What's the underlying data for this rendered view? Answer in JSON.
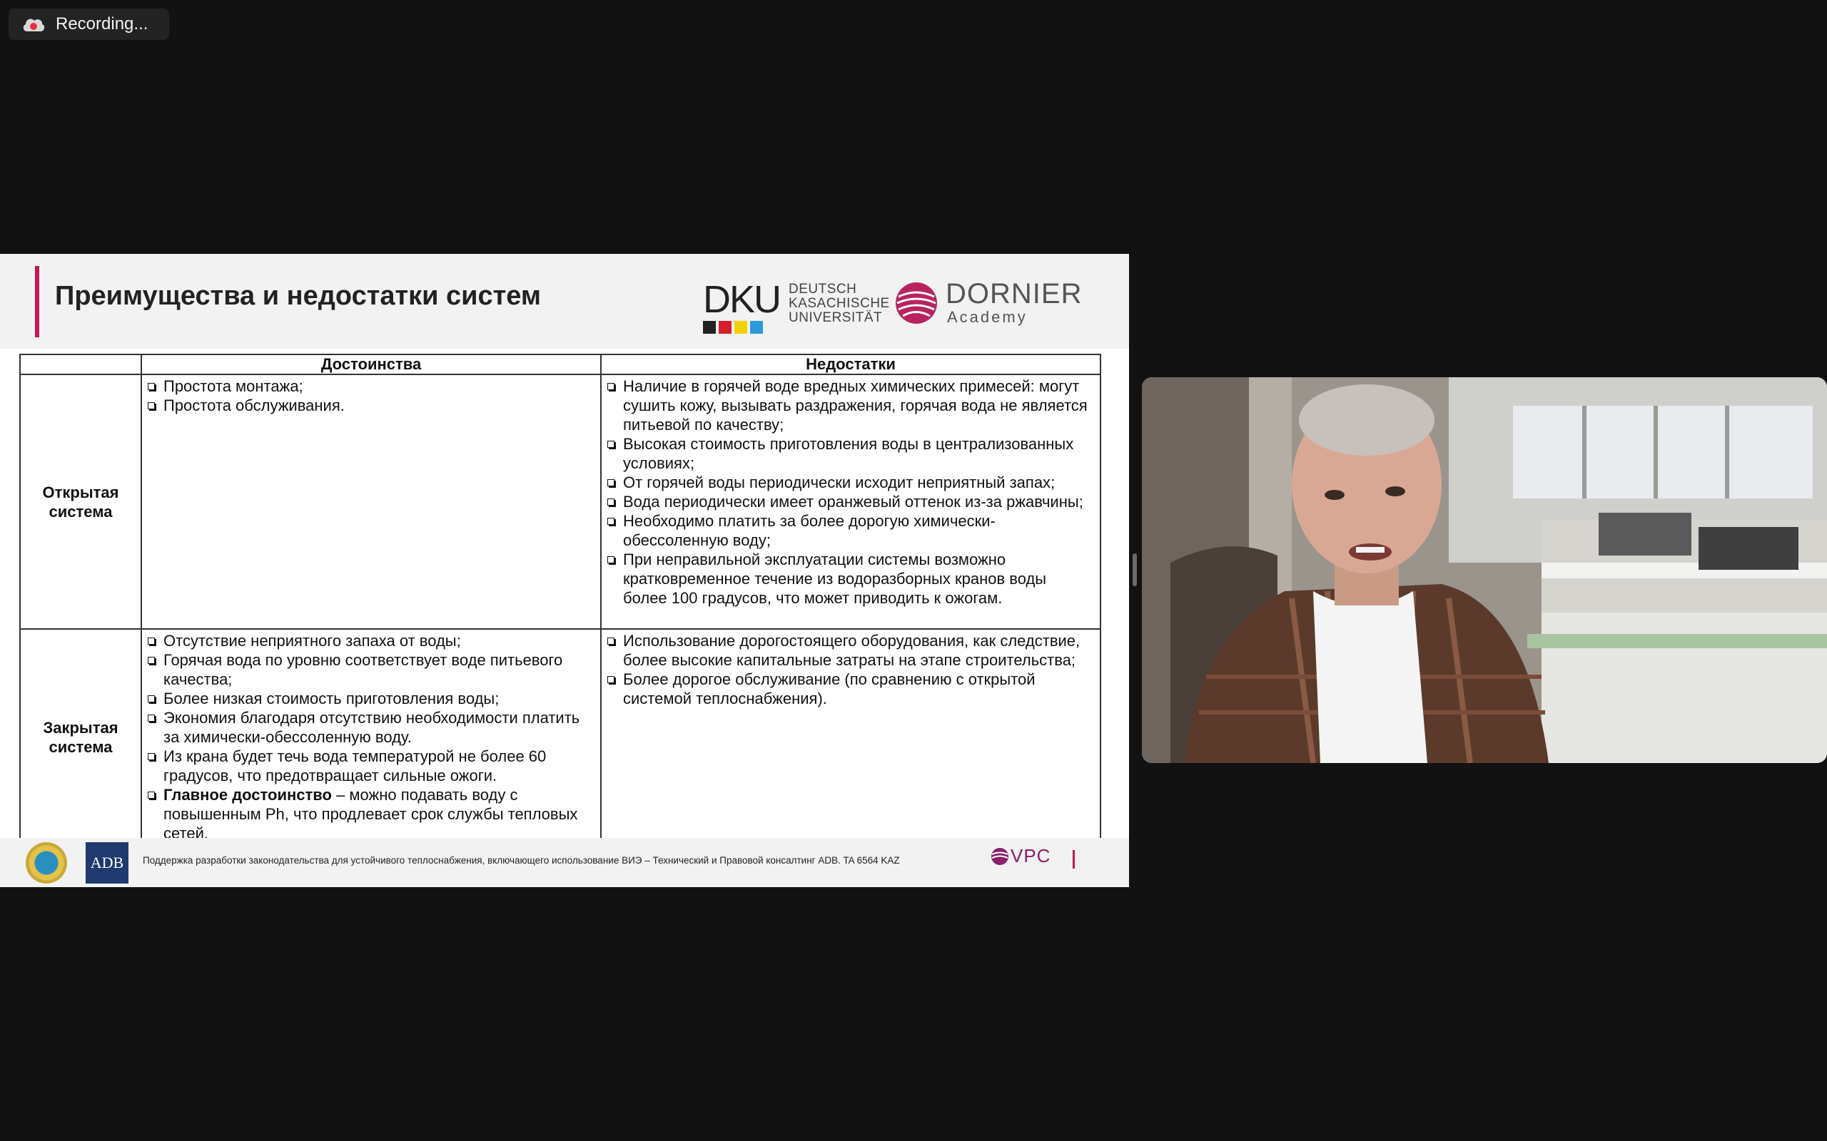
{
  "recording": {
    "label": "Recording..."
  },
  "slide": {
    "title": "Преимущества и недостатки систем",
    "logos": {
      "dku_letters": "DKU",
      "dku_text": [
        "DEUTSCH",
        "KASACHISCHE",
        "UNIVERSITÄT"
      ],
      "dornier_name": "DORNIER",
      "dornier_sub": "Academy",
      "adb": "ADB",
      "vpc": "VPC"
    },
    "table": {
      "headers": [
        "Достоинства",
        "Недостатки"
      ],
      "rows": [
        {
          "label": "Открытая система",
          "advantages": [
            "Простота монтажа;",
            "Простота обслуживания."
          ],
          "disadvantages": [
            "Наличие в горячей воде вредных химических примесей: могут сушить кожу, вызывать раздражения, горячая вода не является питьевой по качеству;",
            "Высокая стоимость приготовления воды в централизованных условиях;",
            "От горячей воды периодически исходит неприятный запах;",
            "Вода периодически имеет оранжевый оттенок из-за ржавчины;",
            "Необходимо платить за более дорогую химически-обессоленную воду;",
            "При неправильной эксплуатации системы возможно кратковременное течение из водоразборных кранов воды более 100 градусов, что может приводить к ожогам."
          ]
        },
        {
          "label": "Закрытая система",
          "advantages": [
            "Отсутствие неприятного запаха от воды;",
            "Горячая вода по уровню соответствует воде питьевого качества;",
            "Более низкая стоимость приготовления воды;",
            "Экономия благодаря отсутствию необходимости платить за химически-обессоленную воду.",
            "Из крана будет течь вода температурой не более 60 градусов, что предотвращает сильные ожоги."
          ],
          "main_advantage_bold": "Главное достоинство",
          "main_advantage_rest": " – можно подавать воду с повышенным Ph, что продлевает срок службы тепловых сетей.",
          "disadvantages": [
            "Использование дорогостоящего оборудования, как следствие, более высокие капитальные затраты на этапе строительства;",
            "Более дорогое обслуживание (по сравнению с открытой системой теплоснабжения)."
          ]
        }
      ]
    },
    "footer_text": "Поддержка разработки законодательства для устойчивого теплоснабжения, включающего использование ВИЭ – Технический и Правовой консалтинг ADB. TA 6564 KAZ"
  },
  "colors": {
    "accent": "#c2185b",
    "background": "#121212",
    "slide_header": "#f2f2f2"
  }
}
